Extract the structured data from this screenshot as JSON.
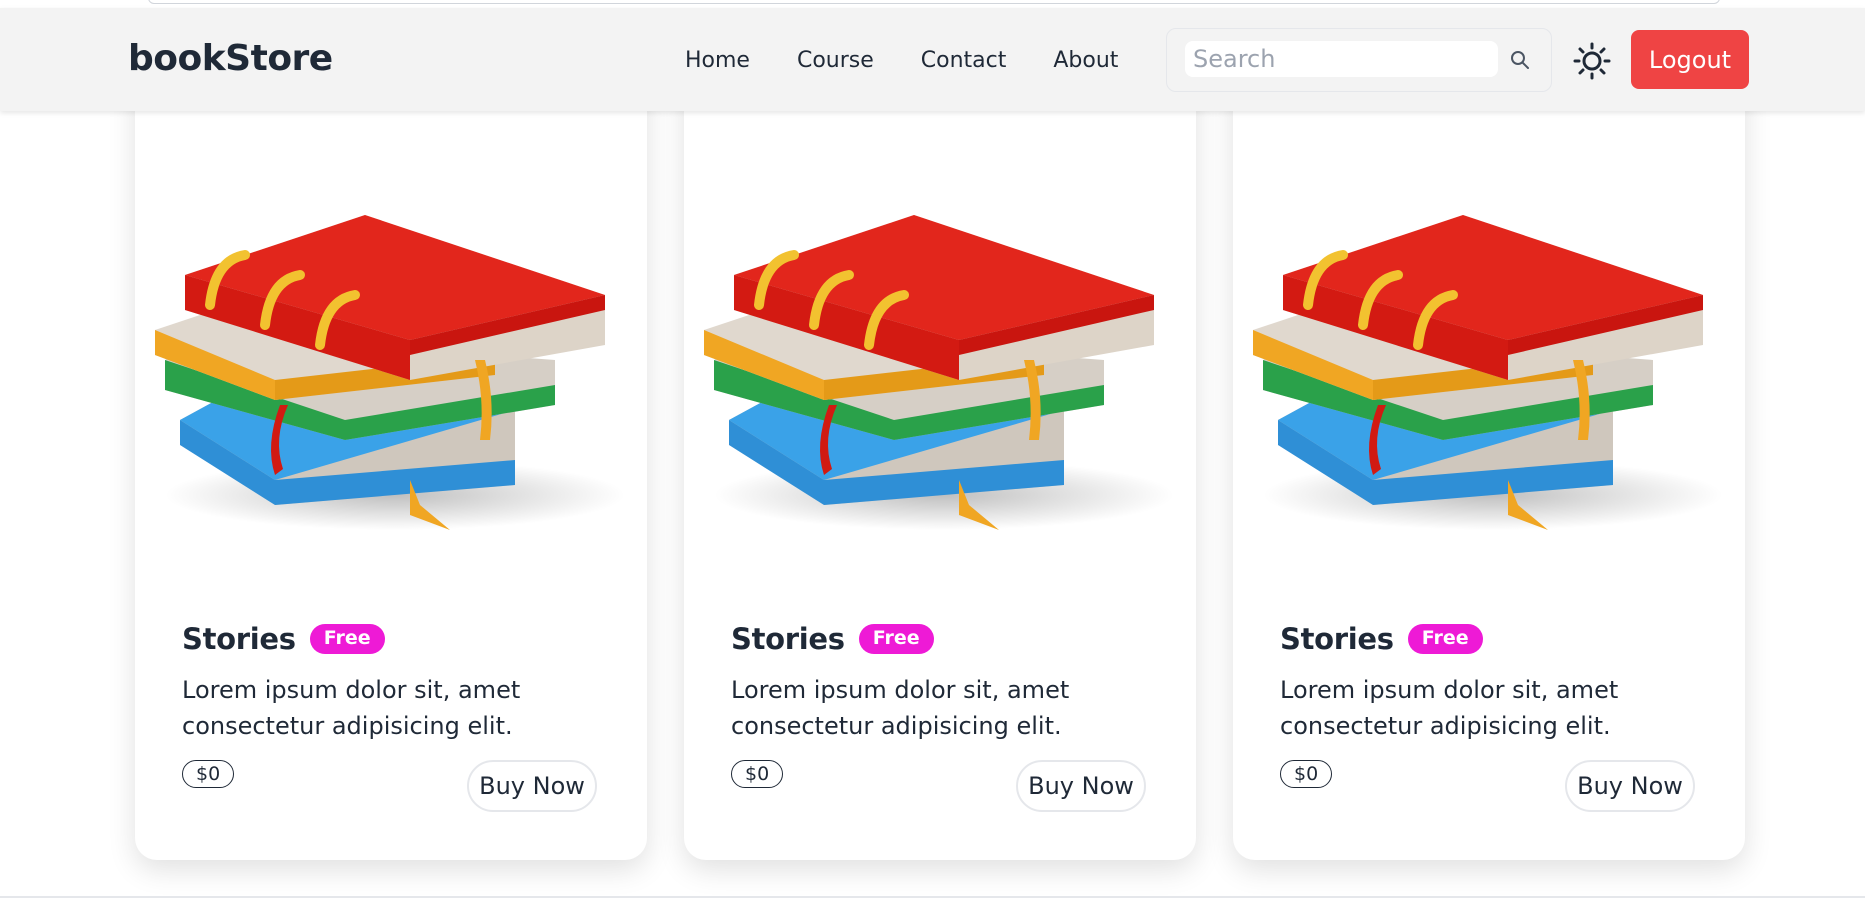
{
  "navbar": {
    "brand": "bookStore",
    "links": [
      "Home",
      "Course",
      "Contact",
      "About"
    ],
    "search_placeholder": "Search",
    "logout_label": "Logout"
  },
  "cards": [
    {
      "title": "Stories",
      "badge": "Free",
      "description": "Lorem ipsum dolor sit, amet consectetur adipisicing elit.",
      "price": "$0",
      "button": "Buy Now"
    },
    {
      "title": "Stories",
      "badge": "Free",
      "description": "Lorem ipsum dolor sit, amet consectetur adipisicing elit.",
      "price": "$0",
      "button": "Buy Now"
    },
    {
      "title": "Stories",
      "badge": "Free",
      "description": "Lorem ipsum dolor sit, amet consectetur adipisicing elit.",
      "price": "$0",
      "button": "Buy Now"
    }
  ],
  "colors": {
    "badge": "#ee1ad6",
    "logout": "#ef4444",
    "navbar_bg": "#f3f3f3",
    "text": "#1f2937"
  },
  "icons": {
    "search": "search-icon",
    "theme_toggle": "sun-icon",
    "product_image": "book-stack-icon"
  }
}
